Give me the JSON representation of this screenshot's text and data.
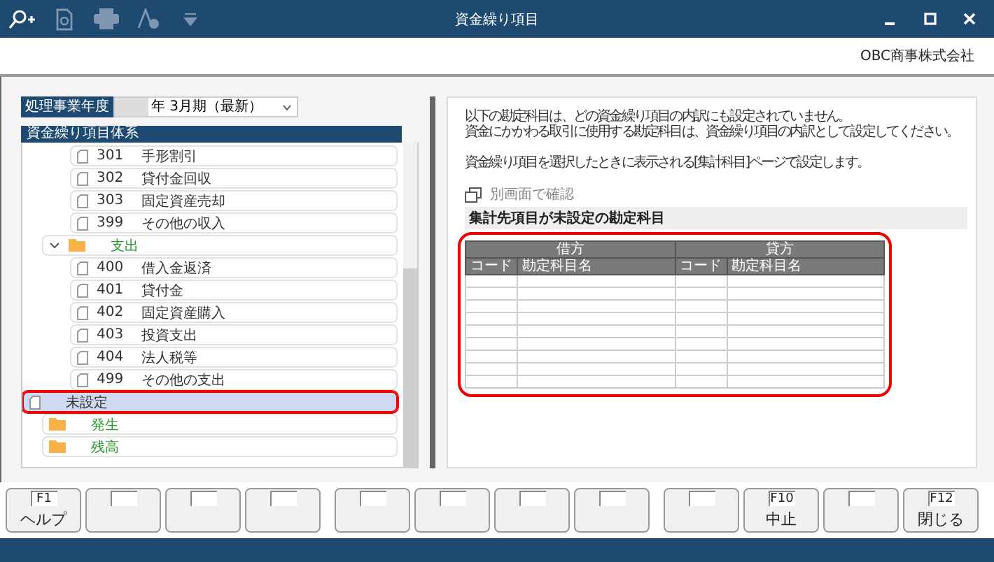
{
  "window": {
    "title": "資金繰り項目",
    "company": "OBC商事株式会社"
  },
  "toolbar": [
    {
      "kind": "zoom",
      "disabled": false
    },
    {
      "kind": "preview",
      "disabled": true
    },
    {
      "kind": "print",
      "disabled": true
    },
    {
      "kind": "sign",
      "disabled": true
    },
    {
      "kind": "dropdown",
      "disabled": true
    }
  ],
  "fiscal_year": {
    "label": "処理事業年度",
    "value": "年  3月期（最新）"
  },
  "tree": {
    "header": "資金繰り項目体系",
    "items": [
      {
        "kind": "branch",
        "children": [
          {
            "kind": "branch",
            "children": [
              {
                "kind": "account",
                "code": "301",
                "name": "手形割引",
                "selected": false
              },
              {
                "kind": "account",
                "code": "302",
                "name": "貸付金回収",
                "selected": false
              },
              {
                "kind": "account",
                "code": "303",
                "name": "固定資産売却",
                "selected": false
              },
              {
                "kind": "account",
                "code": "399",
                "name": "その他の収入",
                "selected": false
              }
            ]
          },
          {
            "kind": "folder",
            "name": "支出",
            "expanded": true,
            "selected": false,
            "children": [
              {
                "kind": "account",
                "code": "400",
                "name": "借入金返済",
                "selected": false
              },
              {
                "kind": "account",
                "code": "401",
                "name": "貸付金",
                "selected": false
              },
              {
                "kind": "account",
                "code": "402",
                "name": "固定資産購入",
                "selected": false
              },
              {
                "kind": "account",
                "code": "403",
                "name": "投資支出",
                "selected": false
              },
              {
                "kind": "account",
                "code": "404",
                "name": "法人税等",
                "selected": false
              },
              {
                "kind": "account",
                "code": "499",
                "name": "その他の支出",
                "selected": false
              }
            ]
          }
        ]
      },
      {
        "kind": "leaf",
        "name": "未設定",
        "selected": true
      },
      {
        "kind": "folder",
        "name": "発生",
        "expanded": false,
        "selected": false
      },
      {
        "kind": "folder",
        "name": "残高",
        "expanded": false,
        "selected": false
      }
    ]
  },
  "detail": {
    "message": [
      "以下の勘定科目は、どの資金繰り項目の内訳にも設定されていません。",
      "資金にかかわる取引に使用する勘定科目は、資金繰り項目の内訳として設定してください。"
    ],
    "note": "資金繰り項目を選択したときに表示される[集計科目]ページで設定します。",
    "link": "別画面で確認",
    "section": "集計先項目が未設定の勘定科目",
    "table": {
      "groups": [
        "借方",
        "貸方"
      ],
      "columns": [
        "コード",
        "勘定科目名",
        "コード",
        "勘定科目名"
      ]
    }
  },
  "function_keys": [
    {
      "kind": "key",
      "key": "F1",
      "label": "ヘルプ"
    },
    {
      "kind": "blank"
    },
    {
      "kind": "blank"
    },
    {
      "kind": "blank"
    },
    {
      "kind": "blank"
    },
    {
      "kind": "blank"
    },
    {
      "kind": "blank"
    },
    {
      "kind": "blank"
    },
    {
      "kind": "blank"
    },
    {
      "kind": "key",
      "key": "F10",
      "label": "中止"
    },
    {
      "kind": "blank"
    },
    {
      "kind": "key",
      "key": "F12",
      "label": "閉じる"
    }
  ]
}
